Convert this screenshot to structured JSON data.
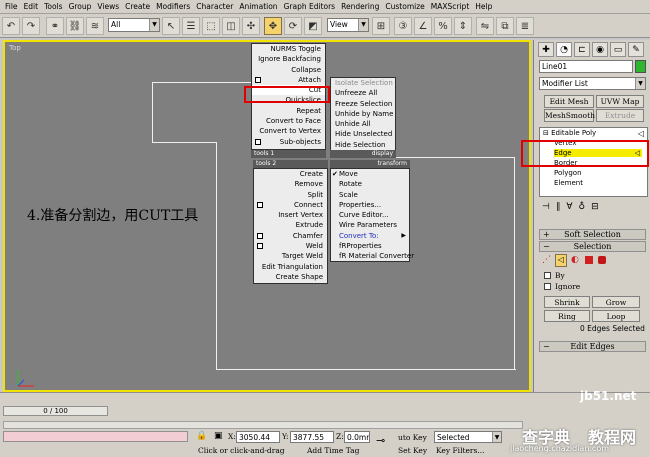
{
  "menubar": {
    "items": [
      "File",
      "Edit",
      "Tools",
      "Group",
      "Views",
      "Create",
      "Modifiers",
      "Character",
      "Animation",
      "Graph Editors",
      "Rendering",
      "Customize",
      "MAXScript",
      "Help"
    ]
  },
  "toolbar": {
    "selection_filter": "All",
    "coord_system": "View"
  },
  "viewport": {
    "label": "Top",
    "annotation": "4.准备分割边，用CUT工具"
  },
  "quad_menu": {
    "tools1": {
      "header": "tools 1",
      "items": [
        "NURMS Toggle",
        "Ignore Backfacing",
        "Collapse",
        "Attach",
        "Cut",
        "Quickslice",
        "Repeat",
        "Convert to Face",
        "Convert to Vertex",
        "Sub-objects"
      ]
    },
    "display": {
      "header": "display",
      "items": [
        "Isolate Selection",
        "Unfreeze All",
        "Freeze Selection",
        "Unhide by Name",
        "Unhide All",
        "Hide Unselected",
        "Hide Selection"
      ]
    },
    "tools2": {
      "header": "tools 2",
      "items": [
        "Create",
        "Remove",
        "Split",
        "Connect",
        "Insert Vertex",
        "Extrude",
        "Chamfer",
        "Weld",
        "Target Weld",
        "Edit Triangulation",
        "Create Shape"
      ]
    },
    "transform": {
      "header": "transform",
      "items": [
        "Move",
        "Rotate",
        "Scale",
        "Properties...",
        "Curve Editor...",
        "Wire Parameters",
        "Convert To:",
        "fRProperties",
        "fR Material Converter"
      ]
    }
  },
  "command_panel": {
    "object_name": "Line01",
    "modifier_list": "Modifier List",
    "buttons": {
      "edit_mesh": "Edit Mesh",
      "uvw_map": "UVW Map",
      "meshsmooth": "MeshSmooth",
      "extrude": "Extrude"
    },
    "stack": {
      "root": "Editable Poly",
      "items": [
        "Vertex",
        "Edge",
        "Border",
        "Polygon",
        "Element"
      ],
      "selected": "Edge"
    },
    "soft_selection": "Soft Selection",
    "selection": {
      "title": "Selection",
      "by_label": "By",
      "ignore_label": "Ignore",
      "shrink": "Shrink",
      "grow": "Grow",
      "ring": "Ring",
      "loop": "Loop",
      "status": "0 Edges Selected"
    },
    "edit_edges": "Edit Edges"
  },
  "status": {
    "time_slider": "0 / 100",
    "x_label": "X:",
    "x_value": "3050.44",
    "y_label": "Y:",
    "y_value": "3877.55",
    "z_label": "Z:",
    "z_value": "0.0mm",
    "auto_key": "uto Key",
    "selected": "Selected",
    "set_key": "Set Key",
    "key_filters": "Key Filters...",
    "prompt": "Click or click-and-drag",
    "add_time_tag": "Add Time Tag"
  },
  "watermark": {
    "site": "jb51.net",
    "text1": "查字典",
    "text2": "教程网",
    "url": "jiaocheng.chazidian.com"
  },
  "colors": {
    "highlight_yellow": "#f5ec00",
    "annotation_red": "#e00000",
    "viewport_gray": "#7f7f7f"
  }
}
